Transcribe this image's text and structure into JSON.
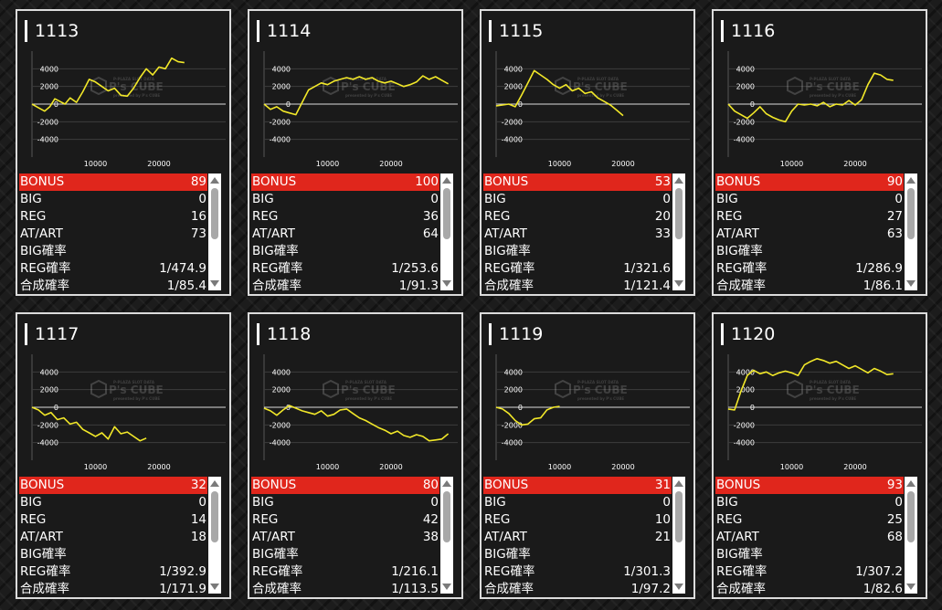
{
  "labels": {
    "bonus": "BONUS",
    "big": "BIG",
    "reg": "REG",
    "atart": "AT/ART",
    "big_rate": "BIG確率",
    "reg_rate": "REG確率",
    "total_rate": "合成確率"
  },
  "watermark": {
    "brand": "P's CUBE",
    "tagline": "P-PLAZA SLOT DATA",
    "sub": "presented by P's CUBE"
  },
  "colors": {
    "line": "#f2e829",
    "bonus_row": "#e0261c",
    "panel_border": "#dcdcdc"
  },
  "icons": [
    "scroll-up-arrow-icon",
    "scroll-down-arrow-icon",
    "pscube-logo-icon"
  ],
  "machines": [
    {
      "id": "1113",
      "bonus": "89",
      "big": "0",
      "reg": "16",
      "atart": "73",
      "big_rate": "",
      "reg_rate": "1/474.9",
      "total_rate": "1/85.4"
    },
    {
      "id": "1114",
      "bonus": "100",
      "big": "0",
      "reg": "36",
      "atart": "64",
      "big_rate": "",
      "reg_rate": "1/253.6",
      "total_rate": "1/91.3"
    },
    {
      "id": "1115",
      "bonus": "53",
      "big": "0",
      "reg": "20",
      "atart": "33",
      "big_rate": "",
      "reg_rate": "1/321.6",
      "total_rate": "1/121.4"
    },
    {
      "id": "1116",
      "bonus": "90",
      "big": "0",
      "reg": "27",
      "atart": "63",
      "big_rate": "",
      "reg_rate": "1/286.9",
      "total_rate": "1/86.1"
    },
    {
      "id": "1117",
      "bonus": "32",
      "big": "0",
      "reg": "14",
      "atart": "18",
      "big_rate": "",
      "reg_rate": "1/392.9",
      "total_rate": "1/171.9"
    },
    {
      "id": "1118",
      "bonus": "80",
      "big": "0",
      "reg": "42",
      "atart": "38",
      "big_rate": "",
      "reg_rate": "1/216.1",
      "total_rate": "1/113.5"
    },
    {
      "id": "1119",
      "bonus": "31",
      "big": "0",
      "reg": "10",
      "atart": "21",
      "big_rate": "",
      "reg_rate": "1/301.3",
      "total_rate": "1/97.2"
    },
    {
      "id": "1120",
      "bonus": "93",
      "big": "0",
      "reg": "25",
      "atart": "68",
      "big_rate": "",
      "reg_rate": "1/307.2",
      "total_rate": "1/82.6"
    }
  ],
  "chart_data": [
    {
      "type": "line",
      "title": "1113",
      "xlabel": "",
      "ylabel": "",
      "xticks": [
        10000,
        20000
      ],
      "yticks": [
        4000,
        2000,
        0,
        -2000,
        -4000
      ],
      "xlim": [
        0,
        30500
      ],
      "ylim": [
        -6000,
        6000
      ],
      "grid": true,
      "x": [
        0,
        1000,
        2000,
        2800,
        3600,
        4400,
        5200,
        6000,
        7000,
        8000,
        9000,
        10000,
        11000,
        12000,
        13000,
        14000,
        15000,
        16000,
        17000,
        18000,
        19000,
        20000,
        21000,
        22000,
        23000,
        24000
      ],
      "y": [
        0,
        -400,
        -800,
        -300,
        600,
        300,
        0,
        700,
        200,
        1400,
        2800,
        2500,
        2000,
        1500,
        1800,
        1000,
        900,
        1800,
        3000,
        4000,
        3300,
        4200,
        4000,
        5200,
        4800,
        4700
      ]
    },
    {
      "type": "line",
      "title": "1114",
      "xlabel": "",
      "ylabel": "",
      "xticks": [
        10000,
        20000
      ],
      "yticks": [
        4000,
        2000,
        0,
        -2000,
        -4000
      ],
      "xlim": [
        0,
        30500
      ],
      "ylim": [
        -6000,
        6000
      ],
      "grid": true,
      "x": [
        0,
        1000,
        2000,
        3000,
        4000,
        5000,
        6000,
        7000,
        8000,
        9000,
        10000,
        11000,
        12000,
        13000,
        14000,
        15000,
        16000,
        17000,
        18000,
        19000,
        20000,
        21000,
        22000,
        23000,
        24000,
        25000,
        26000,
        27000,
        28000,
        29000
      ],
      "y": [
        0,
        -600,
        -300,
        -800,
        -1000,
        -1200,
        200,
        1600,
        2000,
        2400,
        2200,
        2600,
        2800,
        3000,
        2800,
        3100,
        2800,
        3000,
        2600,
        2400,
        2600,
        2300,
        2000,
        2200,
        2500,
        3200,
        2800,
        3100,
        2700,
        2300
      ]
    },
    {
      "type": "line",
      "title": "1115",
      "xlabel": "",
      "ylabel": "",
      "xticks": [
        10000,
        20000
      ],
      "yticks": [
        4000,
        2000,
        0,
        -2000,
        -4000
      ],
      "xlim": [
        0,
        30500
      ],
      "ylim": [
        -6000,
        6000
      ],
      "grid": true,
      "x": [
        0,
        1000,
        2000,
        3000,
        4000,
        5000,
        6000,
        7000,
        8000,
        9000,
        10000,
        11000,
        12000,
        13000,
        14000,
        15000,
        16000,
        17000,
        18000,
        19000,
        20000
      ],
      "y": [
        -200,
        -100,
        0,
        -300,
        1000,
        2400,
        3800,
        3300,
        2800,
        2200,
        1800,
        2200,
        1500,
        1800,
        1200,
        1400,
        700,
        300,
        -100,
        -700,
        -1300
      ]
    },
    {
      "type": "line",
      "title": "1116",
      "xlabel": "",
      "ylabel": "",
      "xticks": [
        10000,
        20000
      ],
      "yticks": [
        4000,
        2000,
        0,
        -2000,
        -4000
      ],
      "xlim": [
        0,
        30500
      ],
      "ylim": [
        -6000,
        6000
      ],
      "grid": true,
      "x": [
        0,
        1000,
        2000,
        3000,
        4000,
        5000,
        6000,
        7000,
        8000,
        9000,
        10000,
        11000,
        12000,
        13000,
        14000,
        15000,
        16000,
        17000,
        18000,
        19000,
        20000,
        21000,
        22000,
        23000,
        24000,
        25000,
        26000
      ],
      "y": [
        0,
        -800,
        -1200,
        -1600,
        -1000,
        -300,
        -1100,
        -1500,
        -1800,
        -2000,
        -800,
        0,
        -100,
        0,
        -200,
        200,
        -300,
        0,
        -100,
        400,
        -100,
        500,
        2200,
        3500,
        3300,
        2800,
        2700
      ]
    },
    {
      "type": "line",
      "title": "1117",
      "xlabel": "",
      "ylabel": "",
      "xticks": [
        10000,
        20000
      ],
      "yticks": [
        4000,
        2000,
        0,
        -2000,
        -4000
      ],
      "xlim": [
        0,
        30500
      ],
      "ylim": [
        -6000,
        6000
      ],
      "grid": true,
      "x": [
        0,
        1000,
        2000,
        3000,
        4000,
        5000,
        6000,
        7000,
        8000,
        9000,
        10000,
        11000,
        12000,
        13000,
        14000,
        15000,
        16000,
        17000,
        18000
      ],
      "y": [
        0,
        -300,
        -900,
        -600,
        -1400,
        -1200,
        -1900,
        -1700,
        -2500,
        -2900,
        -3300,
        -2900,
        -3600,
        -2200,
        -3000,
        -2800,
        -3300,
        -3800,
        -3500
      ]
    },
    {
      "type": "line",
      "title": "1118",
      "xlabel": "",
      "ylabel": "",
      "xticks": [
        10000,
        20000
      ],
      "yticks": [
        4000,
        2000,
        0,
        -2000,
        -4000
      ],
      "xlim": [
        0,
        30500
      ],
      "ylim": [
        -6000,
        6000
      ],
      "grid": true,
      "x": [
        0,
        1000,
        2000,
        3000,
        4000,
        5000,
        6000,
        7000,
        8000,
        9000,
        10000,
        11000,
        12000,
        13000,
        14000,
        15000,
        16000,
        17000,
        18000,
        19000,
        20000,
        21000,
        22000,
        23000,
        24000,
        25000,
        26000,
        27000,
        28000,
        29000
      ],
      "y": [
        -100,
        -400,
        -900,
        -300,
        200,
        -100,
        -400,
        -600,
        -800,
        -400,
        -1000,
        -800,
        -300,
        -200,
        -700,
        -1200,
        -1500,
        -1900,
        -2300,
        -2600,
        -3000,
        -2700,
        -3200,
        -3400,
        -3100,
        -3300,
        -3800,
        -3700,
        -3600,
        -3000
      ]
    },
    {
      "type": "line",
      "title": "1119",
      "xlabel": "",
      "ylabel": "",
      "xticks": [
        10000,
        20000
      ],
      "yticks": [
        4000,
        2000,
        0,
        -2000,
        -4000
      ],
      "xlim": [
        0,
        30500
      ],
      "ylim": [
        -6000,
        6000
      ],
      "grid": true,
      "x": [
        0,
        1000,
        2000,
        3000,
        4000,
        5000,
        6000,
        7000,
        8000,
        9000,
        10000
      ],
      "y": [
        0,
        -200,
        -700,
        -1500,
        -2000,
        -1900,
        -1300,
        -1200,
        -300,
        0,
        100
      ]
    },
    {
      "type": "line",
      "title": "1120",
      "xlabel": "",
      "ylabel": "",
      "xticks": [
        10000,
        20000
      ],
      "yticks": [
        4000,
        2000,
        0,
        -2000,
        -4000
      ],
      "xlim": [
        0,
        30500
      ],
      "ylim": [
        -6000,
        6000
      ],
      "grid": true,
      "x": [
        0,
        1000,
        2000,
        3000,
        4000,
        5000,
        6000,
        7000,
        8000,
        9000,
        10000,
        11000,
        12000,
        13000,
        14000,
        15000,
        16000,
        17000,
        18000,
        19000,
        20000,
        21000,
        22000,
        23000,
        24000,
        25000,
        26000
      ],
      "y": [
        -200,
        -300,
        1800,
        3600,
        4200,
        3800,
        4000,
        3600,
        3900,
        4100,
        3900,
        3600,
        4800,
        5200,
        5500,
        5300,
        5000,
        5200,
        4800,
        4400,
        4700,
        4300,
        3900,
        4400,
        4100,
        3700,
        3800
      ]
    }
  ]
}
